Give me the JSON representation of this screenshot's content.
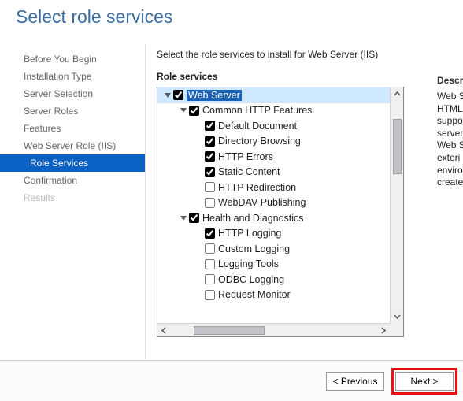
{
  "title": "Select role services",
  "instruction": "Select the role services to install for Web Server (IIS)",
  "section_label": "Role services",
  "sidebar": {
    "items": [
      {
        "label": "Before You Begin",
        "selected": false,
        "enabled": true
      },
      {
        "label": "Installation Type",
        "selected": false,
        "enabled": true
      },
      {
        "label": "Server Selection",
        "selected": false,
        "enabled": true
      },
      {
        "label": "Server Roles",
        "selected": false,
        "enabled": true
      },
      {
        "label": "Features",
        "selected": false,
        "enabled": true
      },
      {
        "label": "Web Server Role (IIS)",
        "selected": false,
        "enabled": true
      },
      {
        "label": "Role Services",
        "selected": true,
        "enabled": true
      },
      {
        "label": "Confirmation",
        "selected": false,
        "enabled": true
      },
      {
        "label": "Results",
        "selected": false,
        "enabled": false
      }
    ]
  },
  "tree": [
    {
      "indent": 0,
      "expander": "▿",
      "checked": true,
      "label": "Web Server",
      "selected": true
    },
    {
      "indent": 1,
      "expander": "▿",
      "checked": true,
      "label": "Common HTTP Features"
    },
    {
      "indent": 2,
      "expander": "",
      "checked": true,
      "label": "Default Document"
    },
    {
      "indent": 2,
      "expander": "",
      "checked": true,
      "label": "Directory Browsing"
    },
    {
      "indent": 2,
      "expander": "",
      "checked": true,
      "label": "HTTP Errors"
    },
    {
      "indent": 2,
      "expander": "",
      "checked": true,
      "label": "Static Content"
    },
    {
      "indent": 2,
      "expander": "",
      "checked": false,
      "label": "HTTP Redirection"
    },
    {
      "indent": 2,
      "expander": "",
      "checked": false,
      "label": "WebDAV Publishing"
    },
    {
      "indent": 1,
      "expander": "▿",
      "checked": true,
      "label": "Health and Diagnostics"
    },
    {
      "indent": 2,
      "expander": "",
      "checked": true,
      "label": "HTTP Logging"
    },
    {
      "indent": 2,
      "expander": "",
      "checked": false,
      "label": "Custom Logging"
    },
    {
      "indent": 2,
      "expander": "",
      "checked": false,
      "label": "Logging Tools"
    },
    {
      "indent": 2,
      "expander": "",
      "checked": false,
      "label": "ODBC Logging"
    },
    {
      "indent": 2,
      "expander": "",
      "checked": false,
      "label": "Request Monitor"
    }
  ],
  "desc": {
    "heading": "Descr",
    "text": "Web S\nHTML\nsuppo\nserver\nWeb S\nexteri\nenviro\ncreate"
  },
  "buttons": {
    "prev": "< Previous",
    "next": "Next >"
  }
}
